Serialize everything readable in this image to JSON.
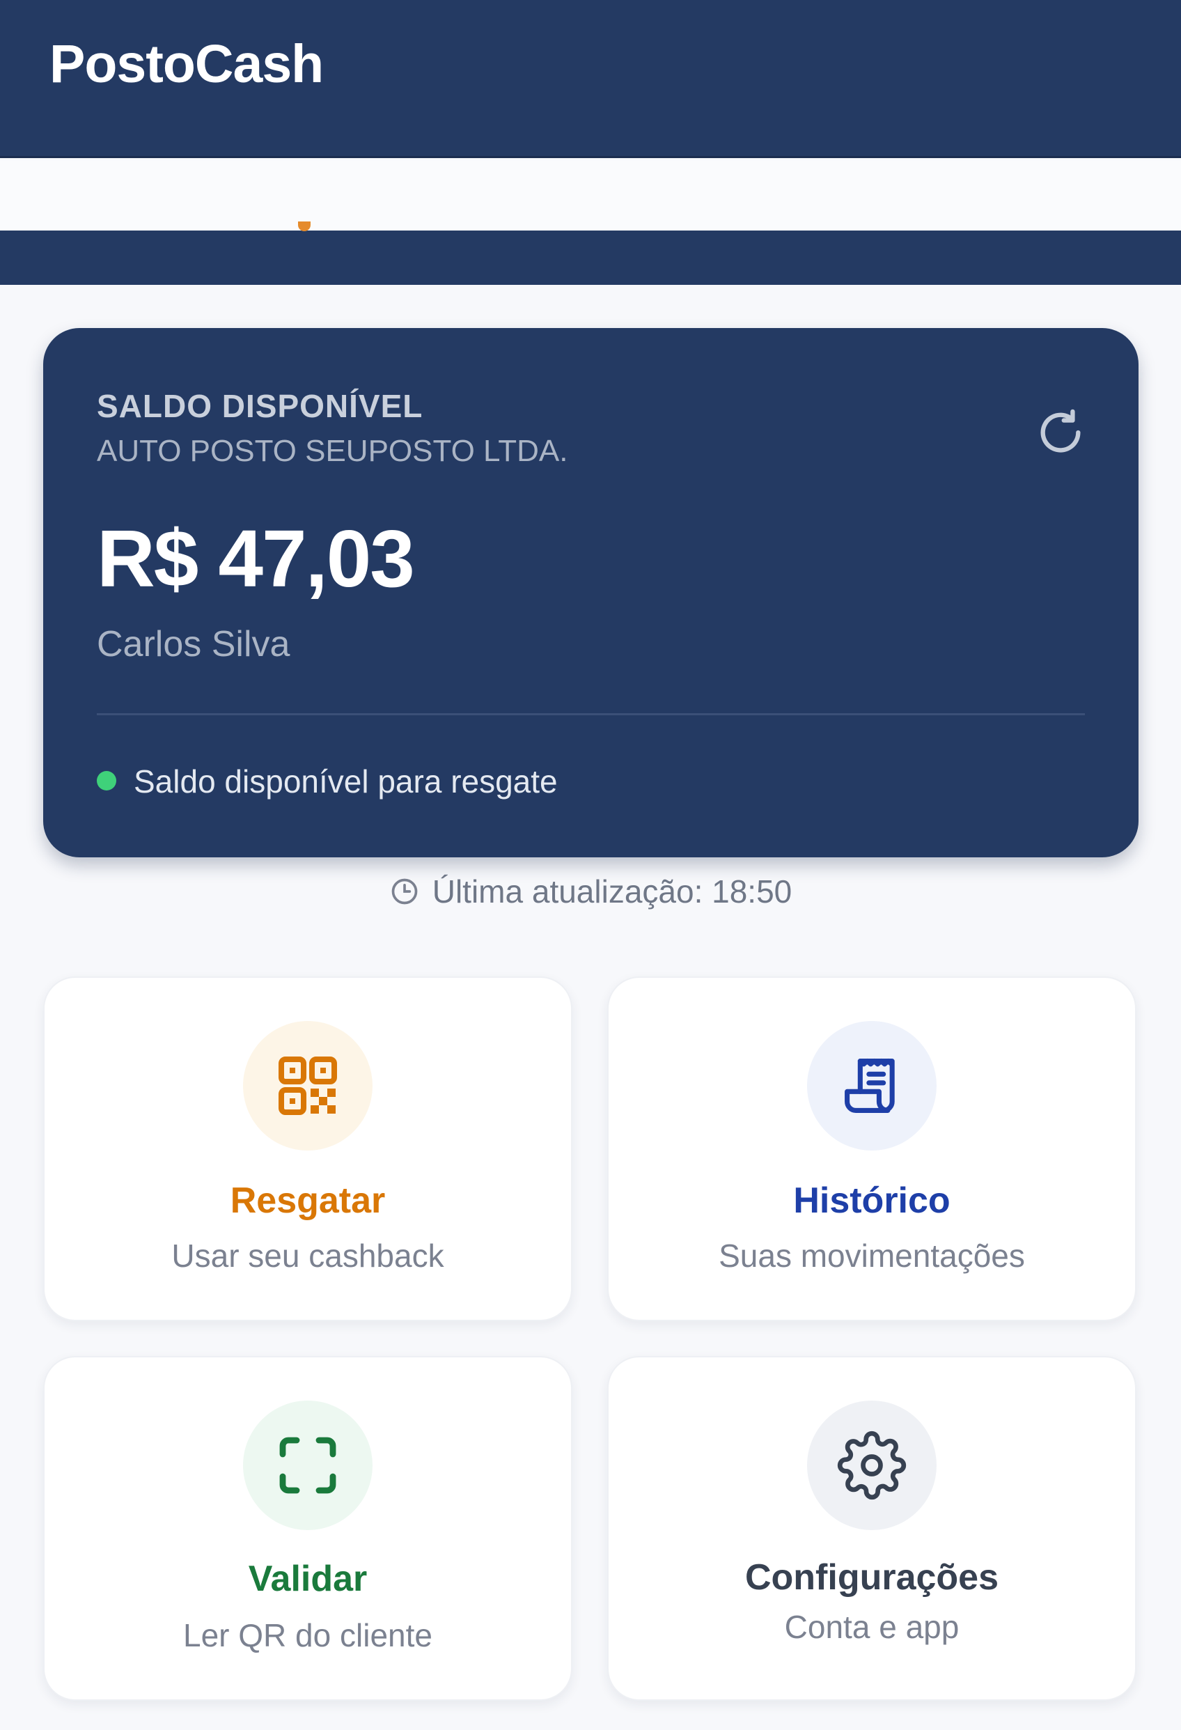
{
  "app": {
    "title": "PostoCash"
  },
  "balance_card": {
    "label": "SALDO DISPONÍVEL",
    "company": "AUTO POSTO SEUPOSTO LTDA.",
    "amount": "R$ 47,03",
    "customer_name": "Carlos Silva",
    "status_text": "Saldo disponível para resgate",
    "refresh_icon": "refresh-icon"
  },
  "last_update": {
    "text": "Última atualização: 18:50",
    "icon": "clock-icon"
  },
  "actions": [
    {
      "title": "Resgatar",
      "subtitle": "Usar seu cashback",
      "icon": "qr-code-icon",
      "color": "#d97706",
      "bg": "#fdf5e7"
    },
    {
      "title": "Histórico",
      "subtitle": "Suas movimentações",
      "icon": "receipt-icon",
      "color": "#1e3fa8",
      "bg": "#eef2fb"
    },
    {
      "title": "Validar",
      "subtitle": "Ler QR do cliente",
      "icon": "scan-icon",
      "color": "#1a7a3c",
      "bg": "#edf8f1"
    },
    {
      "title": "Configurações",
      "subtitle": "Conta e app",
      "icon": "gear-icon",
      "color": "#374151",
      "bg": "#eff1f5"
    }
  ],
  "colors": {
    "header": "#243a63",
    "status_dot": "#3fd17a"
  }
}
